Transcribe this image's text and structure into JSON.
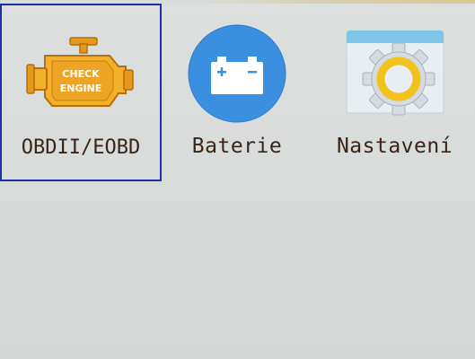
{
  "menu": {
    "items": [
      {
        "label": "OBDII/EOBD",
        "icon": "check-engine-icon",
        "icon_text": [
          "CHECK",
          "ENGINE"
        ],
        "selected": true
      },
      {
        "label": "Baterie",
        "icon": "battery-icon",
        "selected": false
      },
      {
        "label": "Nastavení",
        "icon": "settings-gear-icon",
        "selected": false
      }
    ]
  },
  "colors": {
    "selection_border": "#1f2fa8",
    "engine_orange": "#e8a01e",
    "battery_blue": "#3b8fe0",
    "gear_yellow": "#f1c21b",
    "label_text": "#3a2418"
  }
}
